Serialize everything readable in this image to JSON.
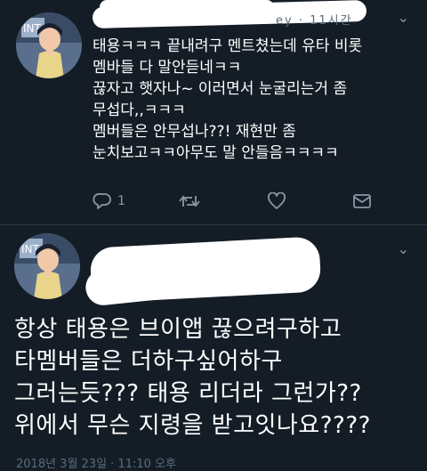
{
  "tweet1": {
    "handle_fragment": "ey · 11시간",
    "lines": [
      "태용ㅋㅋㅋ 끝내려구 멘트쳤는데 유타 비롯",
      "멤바들 다 말안듣네ㅋㅋ",
      "끊자고 햇자나~ 이러면서 눈굴리는거 좀",
      "무섭다,,ㅋㅋㅋ",
      "멤버들은 안무섭나??! 재현만 좀",
      "눈치보고ㅋㅋ아무도 말 안들음ㅋㅋㅋㅋ"
    ],
    "reply_count": "1"
  },
  "tweet2": {
    "lines": [
      "항상 태용은 브이앱 끊으려구하고",
      "타멤버들은 더하구싶어하구",
      "그러는듯??? 태용 리더라 그런가??",
      "위에서 무슨 지령을 받고잇나요????"
    ],
    "timestamp": "2018년 3월 23일 · 11:10 오후"
  },
  "icons": {
    "reply": "reply-icon",
    "retweet": "retweet-icon",
    "like": "heart-icon",
    "dm": "direct-message-icon",
    "more": "chevron-down-icon"
  },
  "colors": {
    "background": "#141d26",
    "text": "#ffffff",
    "muted": "#8899a6",
    "divider": "#2d3b4a"
  }
}
